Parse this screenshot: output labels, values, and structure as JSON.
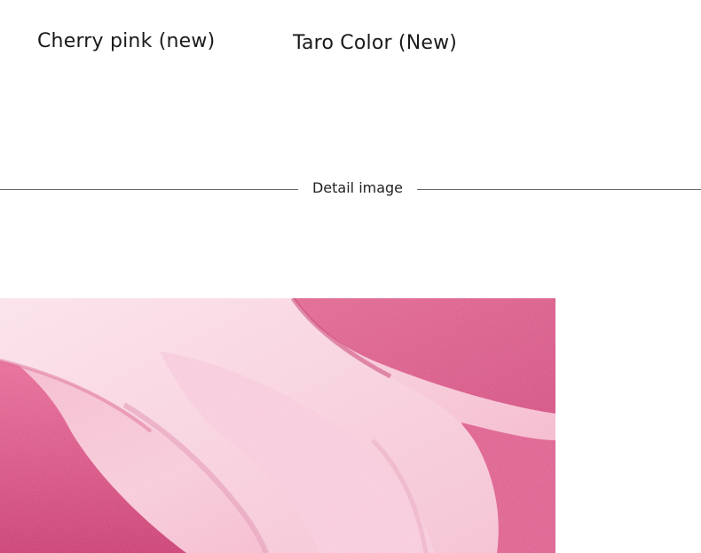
{
  "color_options": [
    {
      "label": "Cherry pink (new)"
    },
    {
      "label": "Taro Color (New)"
    }
  ],
  "section": {
    "title": "Detail image"
  },
  "photo": {
    "subject": "plush fleece fabric close-up",
    "colors": {
      "light_pink": "#f6c6d6",
      "mid_pink": "#ef8fb3",
      "hot_pink": "#e2558b",
      "deep_pink": "#c93a70",
      "shadow": "#b03063"
    }
  }
}
